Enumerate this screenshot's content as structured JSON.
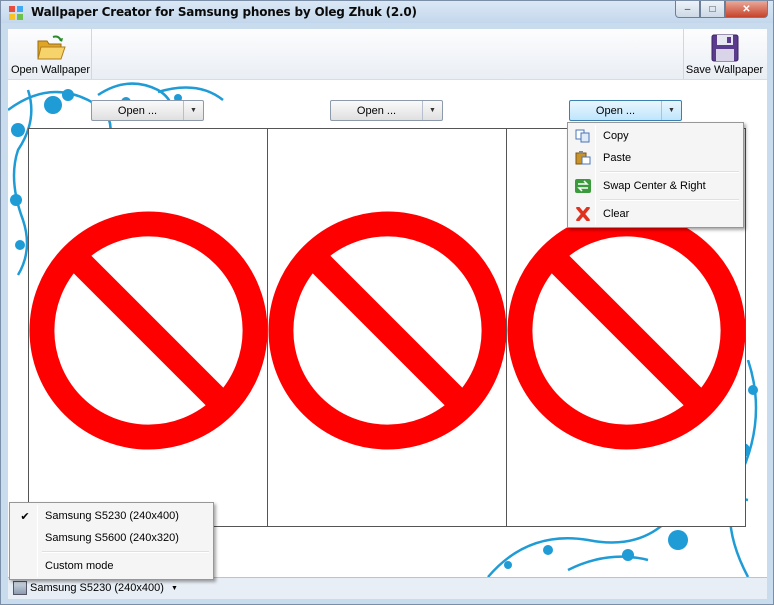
{
  "window": {
    "title": "Wallpaper Creator for Samsung phones by Oleg Zhuk (2.0)",
    "controls": {
      "minimize": "–",
      "maximize": "□",
      "close": "✕"
    }
  },
  "toolbar": {
    "open_label": "Open Wallpaper",
    "save_label": "Save Wallpaper"
  },
  "panels": [
    {
      "open_label": "Open ...",
      "content_icon": "no-image-icon"
    },
    {
      "open_label": "Open ...",
      "content_icon": "no-image-icon"
    },
    {
      "open_label": "Open ...",
      "content_icon": "no-image-icon"
    }
  ],
  "context_menu": {
    "items": [
      {
        "label": "Copy",
        "icon": "copy-icon"
      },
      {
        "label": "Paste",
        "icon": "paste-icon"
      },
      {
        "label": "Swap Center & Right",
        "icon": "swap-icon"
      },
      {
        "label": "Clear",
        "icon": "clear-icon"
      }
    ]
  },
  "model_menu": {
    "items": [
      {
        "label": "Samsung S5230 (240x400)",
        "checked": true
      },
      {
        "label": "Samsung S5600 (240x320)",
        "checked": false
      },
      {
        "label": "Custom mode",
        "checked": false
      }
    ],
    "check_glyph": "✔"
  },
  "statusbar": {
    "device_label": "Samsung S5230 (240x400)",
    "arrow": "▼"
  },
  "colors": {
    "prohibit_red": "#ff0000",
    "floral_blue": "#1f9bd6",
    "title_bg": "#c9dced"
  }
}
